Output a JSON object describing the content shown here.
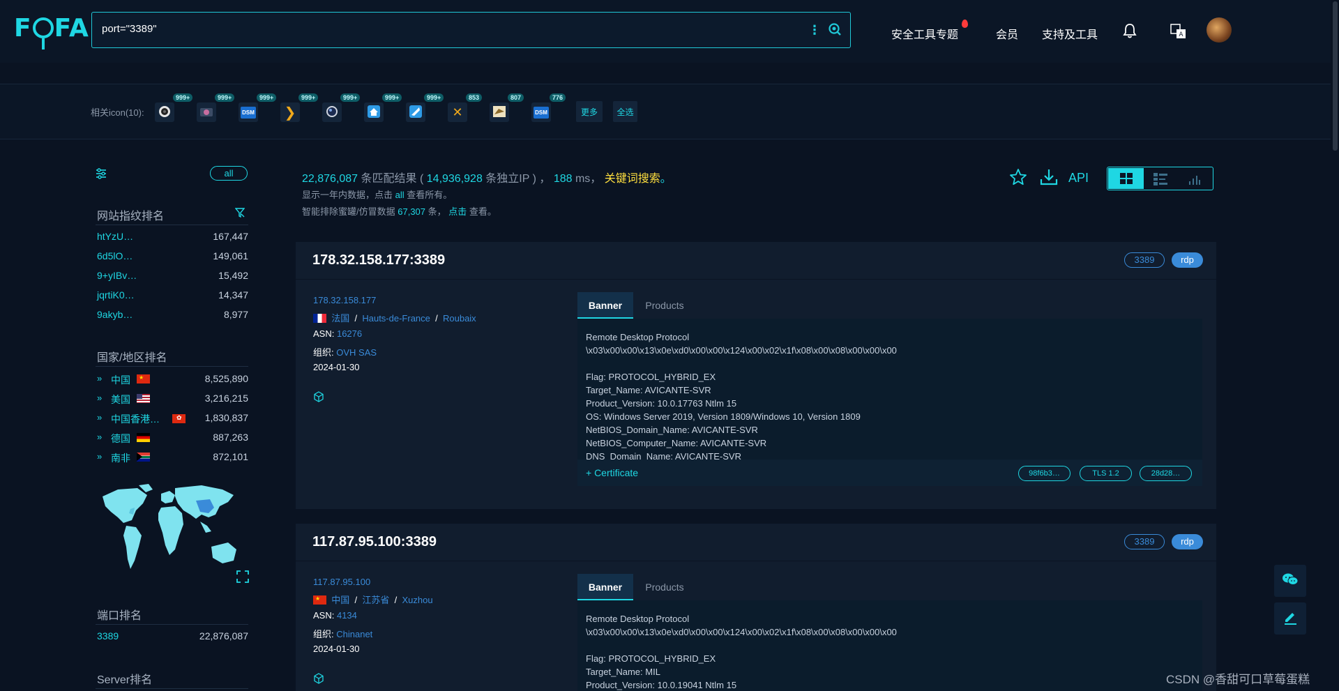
{
  "header": {
    "logo": "FOFA",
    "query": "port=\"3389\"",
    "nav": [
      "安全工具专题",
      "会员",
      "支持及工具"
    ]
  },
  "icon_row": {
    "label": "相关icon(10):",
    "icons": [
      {
        "name": "camera-lens-icon",
        "count": "999+"
      },
      {
        "name": "camera-photo-icon",
        "count": "999+"
      },
      {
        "name": "dsm-icon",
        "count": "999+"
      },
      {
        "name": "plex-chevron-icon",
        "count": "999+"
      },
      {
        "name": "lens-icon",
        "count": "999+"
      },
      {
        "name": "home-network-icon",
        "count": "999+"
      },
      {
        "name": "edge-icon",
        "count": "999+"
      },
      {
        "name": "plex-x-icon",
        "count": "853"
      },
      {
        "name": "bird-logo-icon",
        "count": "807"
      },
      {
        "name": "dsm-icon-2",
        "count": "776"
      }
    ],
    "more": "更多",
    "select_all": "全选"
  },
  "sidebar": {
    "all": "all",
    "fingerprint_title": "网站指纹排名",
    "fingerprints": [
      {
        "name": "htYzU…",
        "value": "167,447"
      },
      {
        "name": "6d5lO…",
        "value": "149,061"
      },
      {
        "name": "9+yIBv…",
        "value": "15,492"
      },
      {
        "name": "jqrtiK0…",
        "value": "14,347"
      },
      {
        "name": "9akyb…",
        "value": "8,977"
      }
    ],
    "country_title": "国家/地区排名",
    "countries": [
      {
        "name": "中国",
        "value": "8,525,890"
      },
      {
        "name": "美国",
        "value": "3,216,215"
      },
      {
        "name": "中国香港…",
        "value": "1,830,837"
      },
      {
        "name": "德国",
        "value": "887,263"
      },
      {
        "name": "南非",
        "value": "872,101"
      }
    ],
    "port_title": "端口排名",
    "ports": [
      {
        "name": "3389",
        "value": "22,876,087"
      }
    ],
    "server_title": "Server排名"
  },
  "results": {
    "total": "22,876,087",
    "matched_label": "条匹配结果 (",
    "unique_ip": "14,936,928",
    "unique_ip_label": "条独立IP ) ，",
    "ms": "188",
    "ms_label": "ms，",
    "keyword": "关键词搜索",
    "period": "。",
    "sub1_a": "显示一年内数据，点击",
    "sub1_all": "all",
    "sub1_b": "查看所有。",
    "sub2_a": "智能排除蜜罐/仿冒数据",
    "sub2_count": "67,307",
    "sub2_b": "条，",
    "sub2_click": "点击",
    "sub2_c": "查看。",
    "api": "API"
  },
  "cards": [
    {
      "host": "178.32.158.177:3389",
      "port_tag": "3389",
      "proto_tag": "rdp",
      "ip": "178.32.158.177",
      "country": "法国",
      "region": "Hauts-de-France",
      "city": "Roubaix",
      "asn_label": "ASN:",
      "asn": "16276",
      "org_label": "组织:",
      "org": "OVH SAS",
      "date": "2024-01-30",
      "tab_banner": "Banner",
      "tab_products": "Products",
      "banner": [
        "Remote Desktop Protocol",
        "\\x03\\x00\\x00\\x13\\x0e\\xd0\\x00\\x00\\x124\\x00\\x02\\x1f\\x08\\x00\\x08\\x00\\x00\\x00",
        "",
        "Flag: PROTOCOL_HYBRID_EX",
        "Target_Name: AVICANTE-SVR",
        "Product_Version: 10.0.17763 Ntlm 15",
        "OS: Windows Server 2019, Version 1809/Windows 10, Version 1809",
        "NetBIOS_Domain_Name: AVICANTE-SVR",
        "NetBIOS_Computer_Name: AVICANTE-SVR",
        "DNS_Domain_Name: AVICANTE-SVR"
      ],
      "certificate": "+ Certificate",
      "chips": [
        "98f6b3…",
        "TLS 1.2",
        "28d28…"
      ]
    },
    {
      "host": "117.87.95.100:3389",
      "port_tag": "3389",
      "proto_tag": "rdp",
      "ip": "117.87.95.100",
      "country": "中国",
      "region": "江苏省",
      "city": "Xuzhou",
      "asn_label": "ASN:",
      "asn": "4134",
      "org_label": "组织:",
      "org": "Chinanet",
      "date": "2024-01-30",
      "tab_banner": "Banner",
      "tab_products": "Products",
      "banner": [
        "Remote Desktop Protocol",
        "\\x03\\x00\\x00\\x13\\x0e\\xd0\\x00\\x00\\x124\\x00\\x02\\x1f\\x08\\x00\\x08\\x00\\x00\\x00",
        "",
        "Flag: PROTOCOL_HYBRID_EX",
        "Target_Name: MIL",
        "Product_Version: 10.0.19041 Ntlm 15"
      ]
    }
  ],
  "watermark": "CSDN @香甜可口草莓蛋糕",
  "colors": {
    "accent": "#1fd7e3",
    "link": "#3a8bd9",
    "highlight": "#ffdf3f",
    "background": "#0a1322"
  }
}
